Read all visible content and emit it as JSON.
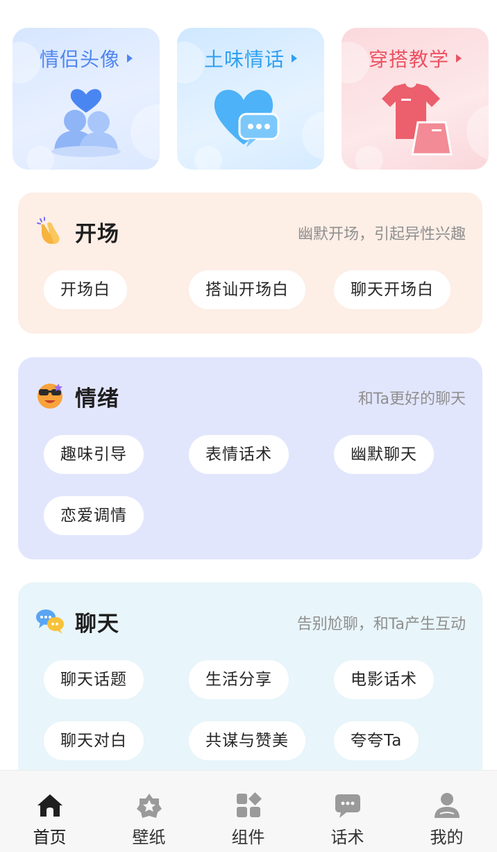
{
  "top_cards": [
    {
      "title": "情侣头像",
      "icon": "couple-heart-icon",
      "color": "#4f86f0"
    },
    {
      "title": "土味情话",
      "icon": "heart-chat-icon",
      "color": "#2fa0f0"
    },
    {
      "title": "穿搭教学",
      "icon": "clothes-icon",
      "color": "#ec5263"
    }
  ],
  "sections": {
    "opening": {
      "icon": "clapping-hands-icon",
      "title": "开场",
      "desc": "幽默开场，引起异性兴趣",
      "bg": "#fdeee6",
      "chips": [
        "开场白",
        "搭讪开场白",
        "聊天开场白"
      ]
    },
    "emotion": {
      "icon": "sunglasses-face-icon",
      "title": "情绪",
      "desc": "和Ta更好的聊天",
      "bg": "#e2e6fd",
      "chips": [
        "趣味引导",
        "表情话术",
        "幽默聊天",
        "恋爱调情"
      ]
    },
    "chat": {
      "icon": "chat-bubbles-icon",
      "title": "聊天",
      "desc": "告别尬聊，和Ta产生互动",
      "bg": "#e8f5fa",
      "chips": [
        "聊天话题",
        "生活分享",
        "电影话术",
        "聊天对白",
        "共谋与赞美",
        "夸夸Ta"
      ]
    }
  },
  "bottom_nav": [
    {
      "label": "首页",
      "icon": "home-icon",
      "active": true
    },
    {
      "label": "壁纸",
      "icon": "star-badge-icon",
      "active": false
    },
    {
      "label": "组件",
      "icon": "widgets-grid-icon",
      "active": false
    },
    {
      "label": "话术",
      "icon": "speech-bubble-icon",
      "active": false
    },
    {
      "label": "我的",
      "icon": "user-icon",
      "active": false
    }
  ]
}
